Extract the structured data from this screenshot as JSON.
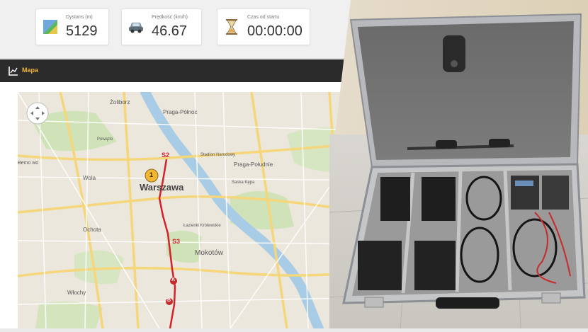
{
  "stats": [
    {
      "label": "Dystans (m)",
      "value": "5129",
      "icon": "map-icon"
    },
    {
      "label": "Prędkość (km/h)",
      "value": "46.67",
      "icon": "car-icon"
    },
    {
      "label": "Czas od startu",
      "value": "00:00:00",
      "icon": "hourglass-icon"
    }
  ],
  "section": {
    "title": "Mapa",
    "icon": "chart-icon"
  },
  "map": {
    "labels": {
      "zoliborz": "Żoliborz",
      "praga_polnoc": "Praga-Północ",
      "stadion": "Stadion Narodowy",
      "praga_poludnie": "Praga-Południe",
      "wola": "Wola",
      "warszawa": "Warszawa",
      "ochota": "Ochota",
      "mokotow": "Mokotów",
      "wlochy": "Włochy",
      "bemowo": "Bemo wo",
      "powazki": "Powązki",
      "lazienki": "Łazienki Królewskie",
      "saska_kepa": "Saska Kępa"
    },
    "markers": {
      "one": "1",
      "s2": "S2",
      "s3": "S3",
      "a": "A",
      "b": "B"
    },
    "colors": {
      "route": "#d2232a",
      "river": "#9ec4e0",
      "park": "#c9dfb0",
      "marker_yellow": "#f2b632",
      "marker_red": "#c62c2c"
    }
  }
}
